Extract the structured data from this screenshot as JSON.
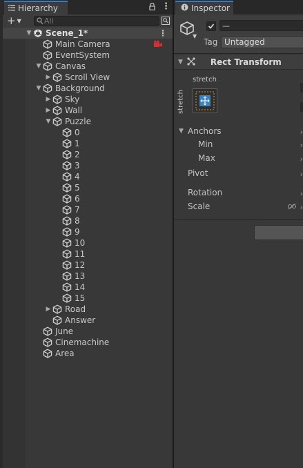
{
  "hierarchy": {
    "tab_label": "Hierarchy",
    "icons": [
      "list-icon",
      "lock-icon",
      "kebab-menu-icon"
    ],
    "search": {
      "placeholder": "All",
      "value": ""
    },
    "scene": {
      "label": "Scene_1*",
      "expanded": true
    },
    "items": [
      {
        "label": "Main Camera",
        "depth": 1,
        "arrow": ""
      },
      {
        "label": "EventSystem",
        "depth": 1,
        "arrow": ""
      },
      {
        "label": "Canvas",
        "depth": 1,
        "arrow": "expanded"
      },
      {
        "label": "Scroll View",
        "depth": 2,
        "arrow": "collapsed"
      },
      {
        "label": "Background",
        "depth": 1,
        "arrow": "expanded"
      },
      {
        "label": "Sky",
        "depth": 2,
        "arrow": "collapsed"
      },
      {
        "label": "Wall",
        "depth": 2,
        "arrow": "collapsed"
      },
      {
        "label": "Puzzle",
        "depth": 2,
        "arrow": "expanded"
      },
      {
        "label": "0",
        "depth": 3,
        "arrow": ""
      },
      {
        "label": "1",
        "depth": 3,
        "arrow": ""
      },
      {
        "label": "2",
        "depth": 3,
        "arrow": ""
      },
      {
        "label": "3",
        "depth": 3,
        "arrow": ""
      },
      {
        "label": "4",
        "depth": 3,
        "arrow": ""
      },
      {
        "label": "5",
        "depth": 3,
        "arrow": ""
      },
      {
        "label": "6",
        "depth": 3,
        "arrow": ""
      },
      {
        "label": "7",
        "depth": 3,
        "arrow": ""
      },
      {
        "label": "8",
        "depth": 3,
        "arrow": ""
      },
      {
        "label": "9",
        "depth": 3,
        "arrow": ""
      },
      {
        "label": "10",
        "depth": 3,
        "arrow": ""
      },
      {
        "label": "11",
        "depth": 3,
        "arrow": ""
      },
      {
        "label": "12",
        "depth": 3,
        "arrow": ""
      },
      {
        "label": "13",
        "depth": 3,
        "arrow": ""
      },
      {
        "label": "14",
        "depth": 3,
        "arrow": ""
      },
      {
        "label": "15",
        "depth": 3,
        "arrow": ""
      },
      {
        "label": "Road",
        "depth": 2,
        "arrow": "collapsed"
      },
      {
        "label": "Answer",
        "depth": 2,
        "arrow": ""
      },
      {
        "label": "June",
        "depth": 1,
        "arrow": ""
      },
      {
        "label": "Cinemachine",
        "depth": 1,
        "arrow": ""
      },
      {
        "label": "Area",
        "depth": 1,
        "arrow": ""
      }
    ]
  },
  "inspector": {
    "tab_label": "Inspector",
    "active_checked": true,
    "name_value": "—",
    "tag_label": "Tag",
    "tag_value": "Untagged",
    "rect_transform": {
      "title": "Rect Transform",
      "anchor_preset_top": "stretch",
      "anchor_preset_side": "stretch",
      "anchors_label": "Anchors",
      "min_label": "Min",
      "max_label": "Max",
      "pivot_label": "Pivot",
      "rotation_label": "Rotation",
      "scale_label": "Scale"
    }
  },
  "colors": {
    "panel": "#383838",
    "background": "#191919",
    "tab_bar": "#282828",
    "tab_active_accent": "#3a79bb",
    "selected_row": "#454545",
    "anchor_preset_blue": "#3f8fd1",
    "anchor_preset_orange": "#d69937",
    "camera_gizmo_red": "#d23232"
  }
}
